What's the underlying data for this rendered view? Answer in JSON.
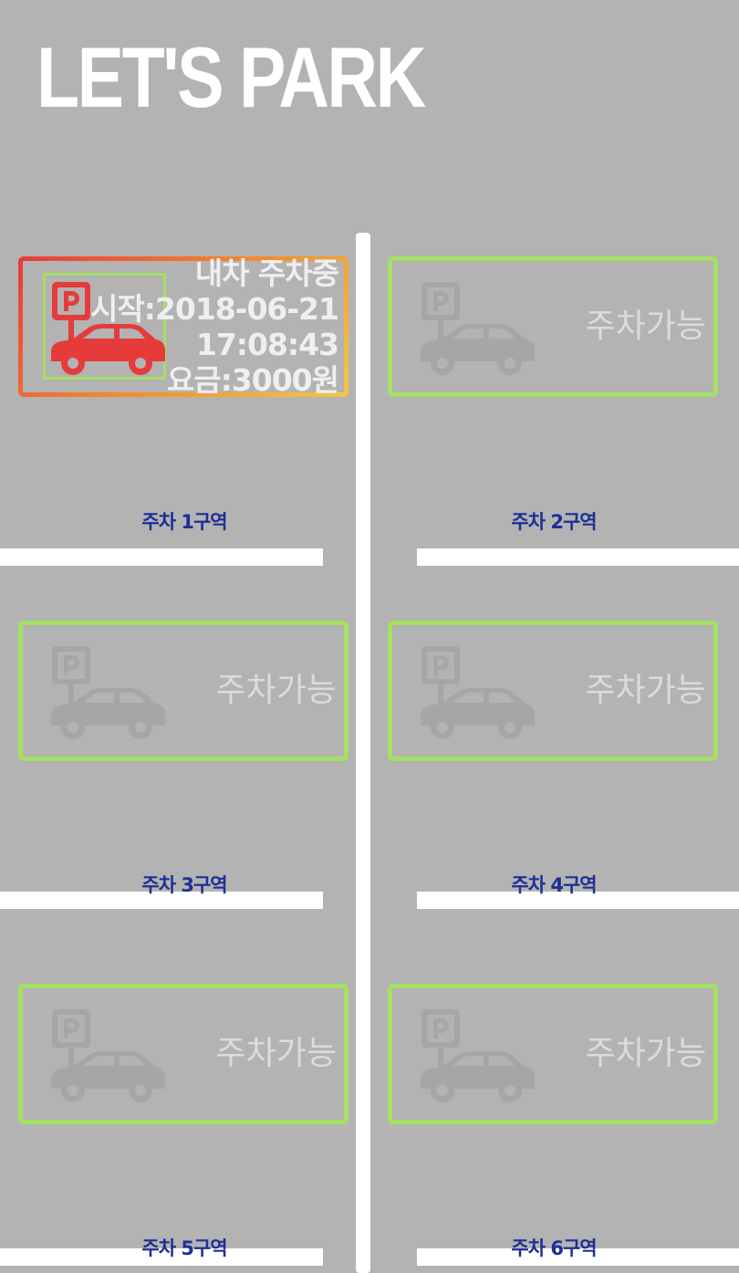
{
  "app": {
    "title": "LET'S PARK"
  },
  "colors": {
    "background": "#b3b3b3",
    "available_border": "#a4e063",
    "occupied_gradient": [
      "#e63b3b",
      "#f2c744"
    ],
    "zone_label": "#1f2f95",
    "occupied_icon": "#e63b3b",
    "available_icon": "#a6a6a6"
  },
  "slots": [
    {
      "status": "occupied",
      "icon": "parking-car-icon",
      "status_text": "내차 주차중",
      "start_label": "시작:2018-06-21",
      "start_time": "17:08:43",
      "fee_label": "요금:3000원",
      "zone_label": "주차 1구역"
    },
    {
      "status": "available",
      "icon": "parking-car-icon",
      "status_text": "주차가능",
      "zone_label": "주차 2구역"
    },
    {
      "status": "available",
      "icon": "parking-car-icon",
      "status_text": "주차가능",
      "zone_label": "주차 3구역"
    },
    {
      "status": "available",
      "icon": "parking-car-icon",
      "status_text": "주차가능",
      "zone_label": "주차 4구역"
    },
    {
      "status": "available",
      "icon": "parking-car-icon",
      "status_text": "주차가능",
      "zone_label": "주차 5구역"
    },
    {
      "status": "available",
      "icon": "parking-car-icon",
      "status_text": "주차가능",
      "zone_label": "주차 6구역"
    }
  ]
}
